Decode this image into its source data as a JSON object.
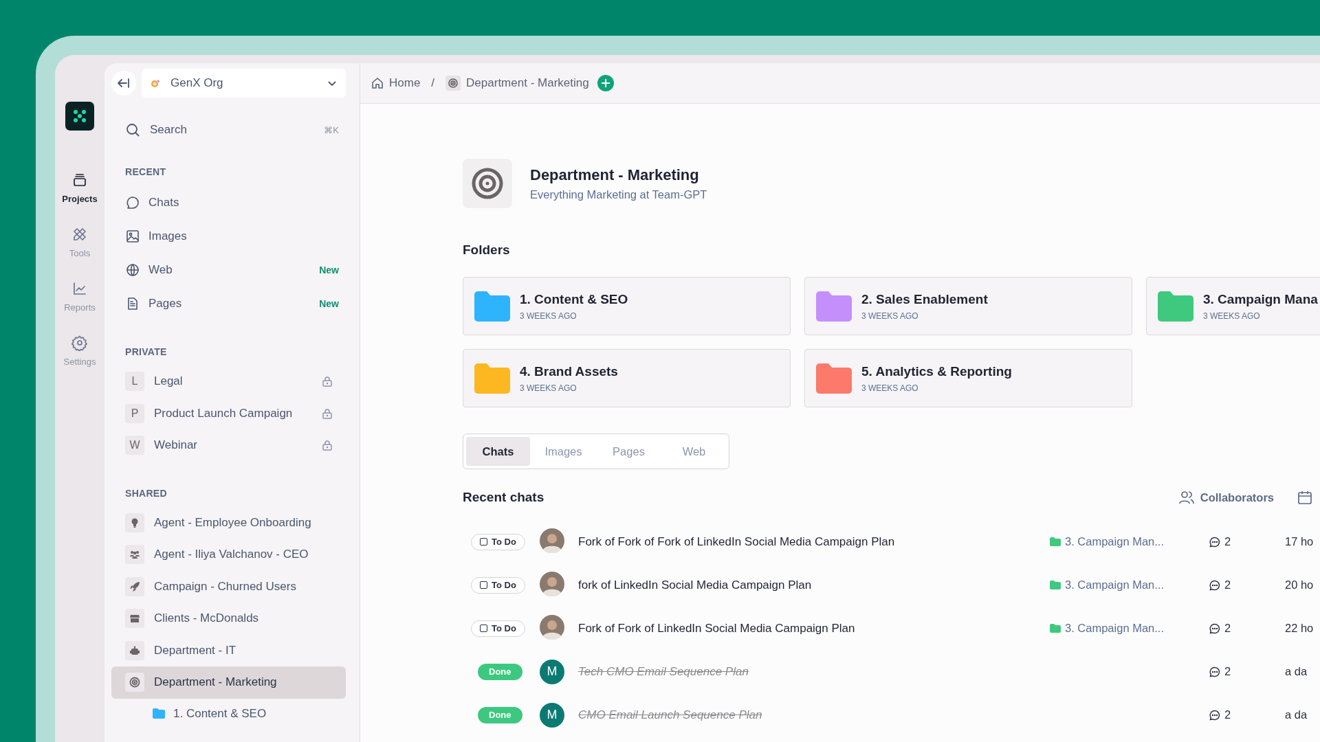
{
  "org": {
    "name": "GenX Org"
  },
  "rail": [
    {
      "kind": "projects",
      "label": "Projects",
      "selected": true
    },
    {
      "kind": "tools",
      "label": "Tools",
      "selected": false
    },
    {
      "kind": "reports",
      "label": "Reports",
      "selected": false
    },
    {
      "kind": "settings",
      "label": "Settings",
      "selected": false
    }
  ],
  "search": {
    "placeholder": "Search",
    "shortcut": "⌘K"
  },
  "recent": {
    "heading": "RECENT",
    "items": [
      {
        "kind": "chats",
        "label": "Chats"
      },
      {
        "kind": "images",
        "label": "Images"
      },
      {
        "kind": "web",
        "label": "Web",
        "badge": "New"
      },
      {
        "kind": "pages",
        "label": "Pages",
        "badge": "New"
      }
    ]
  },
  "private": {
    "heading": "PRIVATE",
    "items": [
      {
        "initial": "L",
        "label": "Legal",
        "locked": true
      },
      {
        "initial": "P",
        "label": "Product Launch Campaign",
        "locked": true
      },
      {
        "initial": "W",
        "label": "Webinar",
        "locked": true
      }
    ]
  },
  "shared": {
    "heading": "SHARED",
    "items": [
      {
        "kind": "bulb",
        "label": "Agent - Employee Onboarding",
        "selected": false
      },
      {
        "kind": "people",
        "label": "Agent - Iliya Valchanov - CEO",
        "selected": false
      },
      {
        "kind": "rocket",
        "label": "Campaign - Churned Users",
        "selected": false
      },
      {
        "kind": "store",
        "label": "Clients - McDonalds",
        "selected": false
      },
      {
        "kind": "robot",
        "label": "Department - IT",
        "selected": false
      },
      {
        "kind": "target",
        "label": "Department - Marketing",
        "selected": true,
        "children": [
          {
            "label": "1. Content & SEO",
            "color": "#2eb4fc"
          }
        ]
      }
    ]
  },
  "breadcrumb": [
    {
      "kind": "home",
      "label": "Home"
    },
    {
      "kind": "target",
      "label": "Department - Marketing"
    }
  ],
  "breadcrumb_separator": "/",
  "project": {
    "title": "Department - Marketing",
    "subtitle": "Everything Marketing at Team-GPT"
  },
  "folders": {
    "heading": "Folders",
    "items": [
      {
        "name": "1. Content & SEO",
        "time": "3 WEEKS AGO",
        "color": "#2eb4fc"
      },
      {
        "name": "2. Sales Enablement",
        "time": "3 WEEKS AGO",
        "color": "#c58ffb"
      },
      {
        "name": "3. Campaign Mana",
        "time": "3 WEEKS AGO",
        "color": "#3fc97f"
      },
      {
        "name": "4. Brand Assets",
        "time": "3 WEEKS AGO",
        "color": "#fdb821"
      },
      {
        "name": "5. Analytics & Reporting",
        "time": "3 WEEKS AGO",
        "color": "#fc7a6c"
      }
    ]
  },
  "tabs": [
    {
      "label": "Chats",
      "selected": true
    },
    {
      "label": "Images",
      "selected": false
    },
    {
      "label": "Pages",
      "selected": false
    },
    {
      "label": "Web",
      "selected": false
    }
  ],
  "recent_chats": {
    "heading": "Recent chats",
    "collaborators": "Collaborators",
    "rows": [
      {
        "status": {
          "kind": "todo",
          "label": "To Do"
        },
        "avatar": {
          "kind": "photo"
        },
        "title": "Fork of Fork of Fork of LinkedIn Social Media Campaign Plan",
        "folder": "3. Campaign Man...",
        "comments": "2",
        "time": "17 ho"
      },
      {
        "status": {
          "kind": "todo",
          "label": "To Do"
        },
        "avatar": {
          "kind": "photo"
        },
        "title": "fork of LinkedIn Social Media Campaign Plan",
        "folder": "3. Campaign Man...",
        "comments": "2",
        "time": "20 ho"
      },
      {
        "status": {
          "kind": "todo",
          "label": "To Do"
        },
        "avatar": {
          "kind": "photo"
        },
        "title": "Fork of Fork of LinkedIn Social Media Campaign Plan",
        "folder": "3. Campaign Man...",
        "comments": "2",
        "time": "22 ho"
      },
      {
        "status": {
          "kind": "done",
          "label": "Done"
        },
        "avatar": {
          "kind": "initial",
          "text": "M"
        },
        "title": "Tech CMO Email Sequence Plan",
        "comments": "2",
        "time": "a da"
      },
      {
        "status": {
          "kind": "done",
          "label": "Done"
        },
        "avatar": {
          "kind": "initial",
          "text": "M"
        },
        "title": "CMO Email Launch Sequence Plan",
        "comments": "2",
        "time": "a da"
      }
    ]
  }
}
